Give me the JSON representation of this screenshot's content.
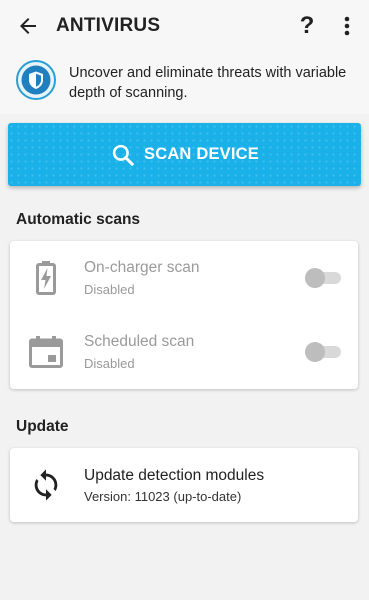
{
  "app_bar": {
    "title": "ANTIVIRUS",
    "help_glyph": "?",
    "back_icon": "arrow-left-icon",
    "more_icon": "more-vertical-icon"
  },
  "intro": {
    "icon": "shield-icon",
    "text": "Uncover and eliminate threats with variable depth of scanning."
  },
  "scan": {
    "label": "SCAN DEVICE",
    "icon": "search-icon",
    "color": "#1ab0e8"
  },
  "automatic_scans": {
    "title": "Automatic scans",
    "items": [
      {
        "title": "On-charger scan",
        "status": "Disabled",
        "icon": "battery-charging-icon",
        "enabled": false
      },
      {
        "title": "Scheduled scan",
        "status": "Disabled",
        "icon": "calendar-icon",
        "enabled": false
      }
    ]
  },
  "update": {
    "title": "Update",
    "item_title": "Update detection modules",
    "item_status": "Version: 11023 (up-to-date)",
    "icon": "sync-icon"
  },
  "colors": {
    "accent": "#1ab0e8",
    "background": "#f2f2f2",
    "disabled_text": "#9a9a9a"
  }
}
